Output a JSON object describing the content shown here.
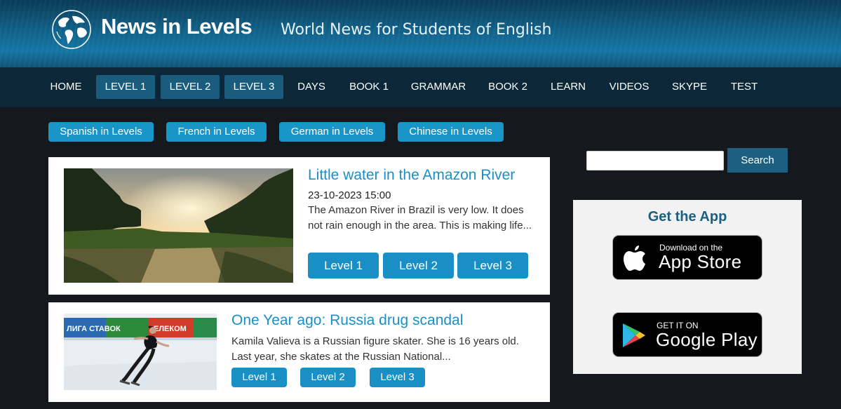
{
  "header": {
    "site_title": "News in Levels",
    "tagline": "World News for Students of English",
    "colors": {
      "header_bg": "#11628a",
      "nav_bg": "#0c2838",
      "accent": "#1a8fc6"
    }
  },
  "nav": {
    "items": [
      {
        "label": "HOME",
        "active": false
      },
      {
        "label": "LEVEL 1",
        "active": true
      },
      {
        "label": "LEVEL 2",
        "active": true
      },
      {
        "label": "LEVEL 3",
        "active": true
      },
      {
        "label": "DAYS",
        "active": false
      },
      {
        "label": "BOOK 1",
        "active": false
      },
      {
        "label": "GRAMMAR",
        "active": false
      },
      {
        "label": "BOOK 2",
        "active": false
      },
      {
        "label": "LEARN",
        "active": false
      },
      {
        "label": "VIDEOS",
        "active": false
      },
      {
        "label": "SKYPE",
        "active": false
      },
      {
        "label": "TEST",
        "active": false
      }
    ]
  },
  "languages": [
    {
      "label": "Spanish in Levels"
    },
    {
      "label": "French in Levels"
    },
    {
      "label": "German in Levels"
    },
    {
      "label": "Chinese in Levels"
    }
  ],
  "articles": [
    {
      "title": "Little water in the Amazon River",
      "date": "23-10-2023 15:00",
      "excerpt": "The Amazon River in Brazil is very low. It does not rain enough in the area. This is making life...",
      "levels": [
        "Level 1",
        "Level 2",
        "Level 3"
      ],
      "image": "amazon-river-sunset-image"
    },
    {
      "title": "One Year ago: Russia drug scandal",
      "date": "",
      "excerpt": "Kamila Valieva is a Russian figure skater. She is 16 years old. Last year, she skates at the Russian National...",
      "levels": [
        "Level 1",
        "Level 2",
        "Level 3"
      ],
      "image": "figure-skater-image"
    }
  ],
  "sidebar": {
    "search": {
      "placeholder": "",
      "button_label": "Search"
    },
    "app": {
      "title": "Get the App",
      "app_store": {
        "small": "Download on the",
        "big": "App Store",
        "icon": "apple-icon"
      },
      "google_play": {
        "small": "GET IT ON",
        "big": "Google Play",
        "icon": "google-play-icon"
      }
    }
  }
}
